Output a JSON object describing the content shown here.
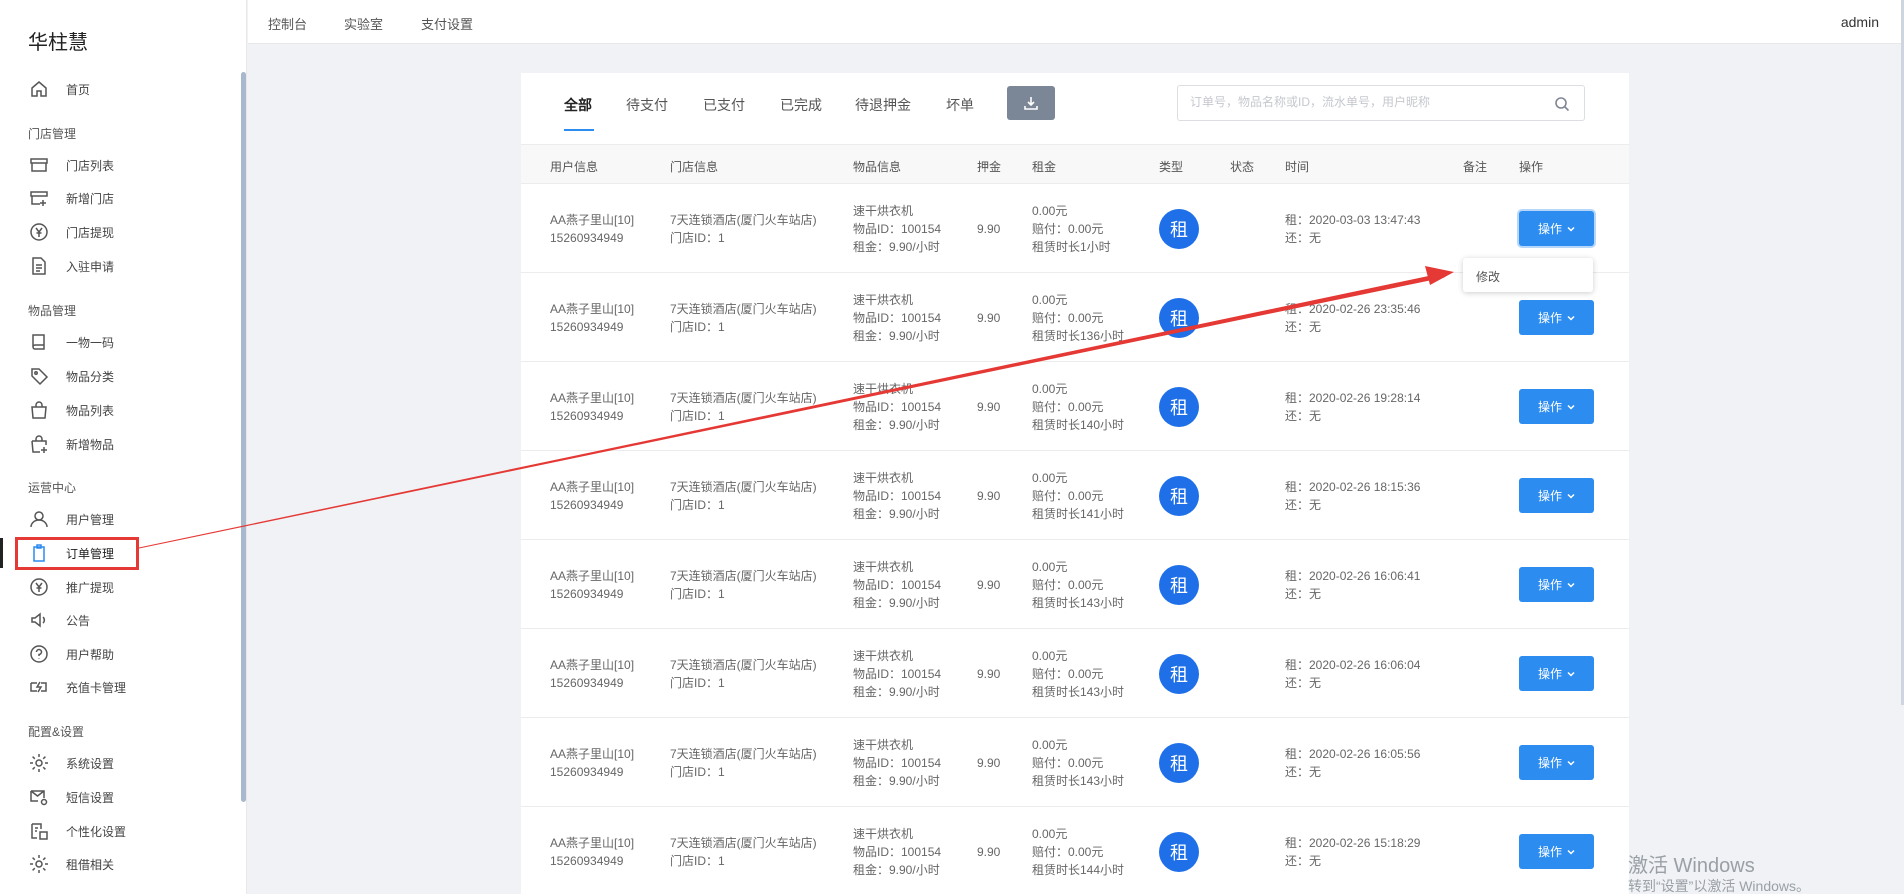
{
  "brand": "华柱慧",
  "sidebar": {
    "groups": [
      {
        "title": ""
      },
      {
        "title": "门店管理"
      },
      {
        "title": "物品管理"
      },
      {
        "title": "运营中心"
      },
      {
        "title": "配置&设置"
      }
    ],
    "items": [
      {
        "label": "首页",
        "icon": "home-icon"
      },
      {
        "label": "门店列表",
        "icon": "store-icon"
      },
      {
        "label": "新增门店",
        "icon": "store-add-icon"
      },
      {
        "label": "门店提现",
        "icon": "yen-icon"
      },
      {
        "label": "入驻申请",
        "icon": "document-icon"
      },
      {
        "label": "一物一码",
        "icon": "book-icon"
      },
      {
        "label": "物品分类",
        "icon": "tag-icon"
      },
      {
        "label": "物品列表",
        "icon": "bag-icon"
      },
      {
        "label": "新增物品",
        "icon": "bag-add-icon"
      },
      {
        "label": "用户管理",
        "icon": "user-icon"
      },
      {
        "label": "订单管理",
        "icon": "clipboard-icon"
      },
      {
        "label": "推广提现",
        "icon": "yen-icon"
      },
      {
        "label": "公告",
        "icon": "speaker-icon"
      },
      {
        "label": "用户帮助",
        "icon": "help-icon"
      },
      {
        "label": "充值卡管理",
        "icon": "charge-card-icon"
      },
      {
        "label": "系统设置",
        "icon": "gear-icon"
      },
      {
        "label": "短信设置",
        "icon": "sms-settings-icon"
      },
      {
        "label": "个性化设置",
        "icon": "customize-icon"
      },
      {
        "label": "租借相关",
        "icon": "gear-icon"
      }
    ]
  },
  "topbar": {
    "nav": [
      "控制台",
      "实验室",
      "支付设置"
    ],
    "user": "admin"
  },
  "tabs": [
    "全部",
    "待支付",
    "已支付",
    "已完成",
    "待退押金",
    "坏单"
  ],
  "search": {
    "placeholder": "订单号，物品名称或ID，流水单号，用户昵称"
  },
  "table": {
    "headers": [
      "用户信息",
      "门店信息",
      "物品信息",
      "押金",
      "租金",
      "类型",
      "状态",
      "时间",
      "备注",
      "操作"
    ],
    "rows": [
      {
        "user": "AA燕子里山[10]",
        "phone": "15260934949",
        "store": "7天连锁酒店(厦门火车站店)",
        "store_id": "门店ID：1",
        "item": "速干烘衣机",
        "item_id": "物品ID：100154",
        "rent_rate": "租金：9.90/小时",
        "deposit": "9.90",
        "rent": "0.00元",
        "compensation": "赔付：0.00元",
        "duration": "租赁时长1小时",
        "type": "租",
        "rent_time": "租：2020-03-03 13:47:43",
        "return_time": "还：无",
        "op": "操作"
      },
      {
        "user": "AA燕子里山[10]",
        "phone": "15260934949",
        "store": "7天连锁酒店(厦门火车站店)",
        "store_id": "门店ID：1",
        "item": "速干烘衣机",
        "item_id": "物品ID：100154",
        "rent_rate": "租金：9.90/小时",
        "deposit": "9.90",
        "rent": "0.00元",
        "compensation": "赔付：0.00元",
        "duration": "租赁时长136小时",
        "type": "租",
        "rent_time": "租：2020-02-26 23:35:46",
        "return_time": "还：无",
        "op": "操作"
      },
      {
        "user": "AA燕子里山[10]",
        "phone": "15260934949",
        "store": "7天连锁酒店(厦门火车站店)",
        "store_id": "门店ID：1",
        "item": "速干烘衣机",
        "item_id": "物品ID：100154",
        "rent_rate": "租金：9.90/小时",
        "deposit": "9.90",
        "rent": "0.00元",
        "compensation": "赔付：0.00元",
        "duration": "租赁时长140小时",
        "type": "租",
        "rent_time": "租：2020-02-26 19:28:14",
        "return_time": "还：无",
        "op": "操作"
      },
      {
        "user": "AA燕子里山[10]",
        "phone": "15260934949",
        "store": "7天连锁酒店(厦门火车站店)",
        "store_id": "门店ID：1",
        "item": "速干烘衣机",
        "item_id": "物品ID：100154",
        "rent_rate": "租金：9.90/小时",
        "deposit": "9.90",
        "rent": "0.00元",
        "compensation": "赔付：0.00元",
        "duration": "租赁时长141小时",
        "type": "租",
        "rent_time": "租：2020-02-26 18:15:36",
        "return_time": "还：无",
        "op": "操作"
      },
      {
        "user": "AA燕子里山[10]",
        "phone": "15260934949",
        "store": "7天连锁酒店(厦门火车站店)",
        "store_id": "门店ID：1",
        "item": "速干烘衣机",
        "item_id": "物品ID：100154",
        "rent_rate": "租金：9.90/小时",
        "deposit": "9.90",
        "rent": "0.00元",
        "compensation": "赔付：0.00元",
        "duration": "租赁时长143小时",
        "type": "租",
        "rent_time": "租：2020-02-26 16:06:41",
        "return_time": "还：无",
        "op": "操作"
      },
      {
        "user": "AA燕子里山[10]",
        "phone": "15260934949",
        "store": "7天连锁酒店(厦门火车站店)",
        "store_id": "门店ID：1",
        "item": "速干烘衣机",
        "item_id": "物品ID：100154",
        "rent_rate": "租金：9.90/小时",
        "deposit": "9.90",
        "rent": "0.00元",
        "compensation": "赔付：0.00元",
        "duration": "租赁时长143小时",
        "type": "租",
        "rent_time": "租：2020-02-26 16:06:04",
        "return_time": "还：无",
        "op": "操作"
      },
      {
        "user": "AA燕子里山[10]",
        "phone": "15260934949",
        "store": "7天连锁酒店(厦门火车站店)",
        "store_id": "门店ID：1",
        "item": "速干烘衣机",
        "item_id": "物品ID：100154",
        "rent_rate": "租金：9.90/小时",
        "deposit": "9.90",
        "rent": "0.00元",
        "compensation": "赔付：0.00元",
        "duration": "租赁时长143小时",
        "type": "租",
        "rent_time": "租：2020-02-26 16:05:56",
        "return_time": "还：无",
        "op": "操作"
      },
      {
        "user": "AA燕子里山[10]",
        "phone": "15260934949",
        "store": "7天连锁酒店(厦门火车站店)",
        "store_id": "门店ID：1",
        "item": "速干烘衣机",
        "item_id": "物品ID：100154",
        "rent_rate": "租金：9.90/小时",
        "deposit": "9.90",
        "rent": "0.00元",
        "compensation": "赔付：0.00元",
        "duration": "租赁时长144小时",
        "type": "租",
        "rent_time": "租：2020-02-26 15:18:29",
        "return_time": "还：无",
        "op": "操作"
      }
    ]
  },
  "dropdown": {
    "items": [
      "修改"
    ]
  },
  "watermark": {
    "line1": "激活 Windows",
    "line2": "转到“设置”以激活 Windows。"
  },
  "colors": {
    "primary": "#2d8cf0",
    "badge": "#1e6fe8",
    "annotation": "#e53935"
  }
}
